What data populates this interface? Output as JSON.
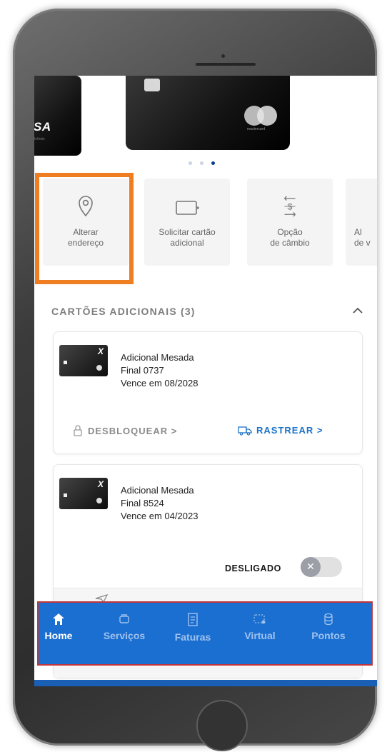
{
  "cards": {
    "visa_logo": "VISA",
    "visa_sub": "Infinite",
    "mastercard_label": "mastercard"
  },
  "carousel": {
    "pages": 3,
    "active_index": 2
  },
  "quick_actions": [
    {
      "label": "Alterar\nendereço",
      "icon": "location-pin-icon"
    },
    {
      "label": "Solicitar cartão\nadicional",
      "icon": "add-card-icon"
    },
    {
      "label": "Opção\nde câmbio",
      "icon": "currency-exchange-icon"
    },
    {
      "label": "Al\nde v",
      "icon": ""
    }
  ],
  "section": {
    "title": "CARTÕES ADICIONAIS (3)",
    "expanded": true
  },
  "additional_cards": [
    {
      "name": "Adicional Mesada",
      "final": "Final 0737",
      "expiry": "Vence em 08/2028",
      "unlock_label": "DESBLOQUEAR",
      "track_label": "RASTREAR"
    },
    {
      "name": "Adicional Mesada",
      "final": "Final 8524",
      "expiry": "Vence em 04/2023",
      "toggle_label": "DESLIGADO",
      "toggle_on": false
    }
  ],
  "bottom_nav": [
    {
      "label": "Home",
      "icon": "home-icon",
      "active": true
    },
    {
      "label": "Serviços",
      "icon": "services-icon",
      "active": false
    },
    {
      "label": "Faturas",
      "icon": "invoice-icon",
      "active": false
    },
    {
      "label": "Virtual",
      "icon": "virtual-card-icon",
      "active": false
    },
    {
      "label": "Pontos",
      "icon": "points-icon",
      "active": false
    }
  ],
  "colors": {
    "highlight": "#ef7d22",
    "nav_bg": "#1b6fd0",
    "link_blue": "#1a72c7",
    "dot_active": "#0b3c8d"
  }
}
